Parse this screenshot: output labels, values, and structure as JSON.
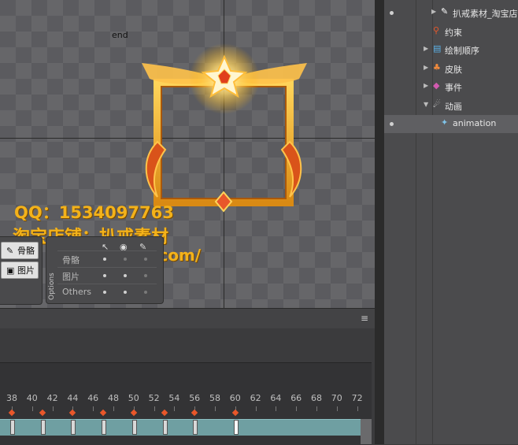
{
  "viewport": {
    "end_label": "end",
    "watermark": {
      "line1": "QQ：1534097763",
      "line2": "淘宝店铺：扒戒素材",
      "line3": "o.com/"
    }
  },
  "tool_buttons": [
    {
      "label": "骨骼",
      "icon": "bone-icon"
    },
    {
      "label": "图片",
      "icon": "image-icon"
    }
  ],
  "options": {
    "title": "Options",
    "rows": [
      "骨骼",
      "图片",
      "Others"
    ]
  },
  "timeline": {
    "ruler": [
      "38",
      "40",
      "42",
      "44",
      "46",
      "48",
      "50",
      "52",
      "54",
      "56",
      "58",
      "60",
      "62",
      "64",
      "66",
      "68",
      "70",
      "72"
    ],
    "keyframes": [
      38,
      41,
      44,
      47,
      50,
      53,
      56,
      60
    ],
    "current_frame": 60
  },
  "tree": {
    "items": [
      {
        "label": "扒戒素材_淘宝店",
        "icon": "brush-icon",
        "indent": 3,
        "expander": true,
        "eye": true
      },
      {
        "label": "约束",
        "icon": "constraint-icon",
        "indent": 2,
        "expander": false,
        "eye": false
      },
      {
        "label": "绘制顺序",
        "icon": "draw-order-icon",
        "indent": 2,
        "expander": true,
        "eye": false
      },
      {
        "label": "皮肤",
        "icon": "skin-icon",
        "indent": 2,
        "expander": true,
        "eye": false
      },
      {
        "label": "事件",
        "icon": "event-icon",
        "indent": 2,
        "expander": true,
        "eye": false
      },
      {
        "label": "动画",
        "icon": "animation-icon",
        "indent": 2,
        "expander": true,
        "eye": false
      },
      {
        "label": "animation",
        "icon": "animation-clip-icon",
        "indent": 3,
        "expander": false,
        "eye": true
      }
    ],
    "selected_index": 6
  },
  "colors": {
    "keyframe": "#e8572a",
    "track": "#6f9fa2",
    "watermark": "#f3b21a"
  }
}
